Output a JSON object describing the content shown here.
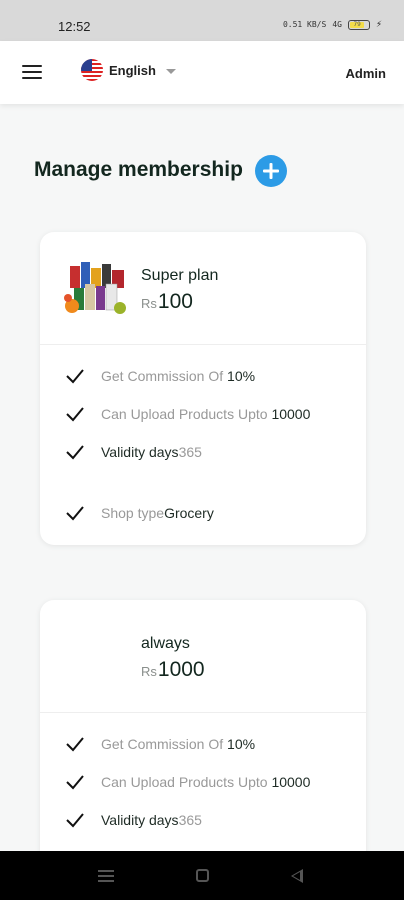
{
  "status_bar": {
    "time": "12:52",
    "network_label": "0.51 KB/S",
    "signal_label": "4G",
    "battery_level": "79"
  },
  "app_bar": {
    "language": "English",
    "user": "Admin"
  },
  "page": {
    "title": "Manage membership"
  },
  "currency": "Rs",
  "plans": [
    {
      "name": "Super plan",
      "price": "100",
      "commission_label": "Get Commission Of ",
      "commission_value": "10%",
      "upload_label": "Can Upload Products Upto ",
      "upload_value": "10000",
      "validity_label": "Validity days",
      "validity_value": "365",
      "shop_label": "Shop type",
      "shop_value": "Grocery"
    },
    {
      "name": "always",
      "price": "1000",
      "commission_label": "Get Commission Of ",
      "commission_value": "10%",
      "upload_label": "Can Upload Products Upto ",
      "upload_value": "10000",
      "validity_label": "Validity days",
      "validity_value": "365"
    }
  ],
  "colors": {
    "accent": "#2c9be6",
    "text_dark": "#13271f",
    "text_muted": "#999999"
  }
}
